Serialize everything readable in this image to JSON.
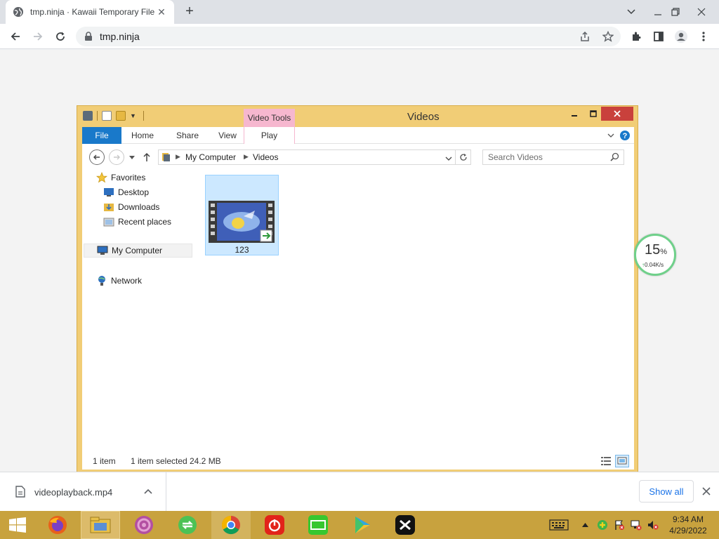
{
  "browser": {
    "tab_title": "tmp.ninja · Kawaii Temporary File",
    "url": "tmp.ninja",
    "new_tab_label": "+",
    "tab_close_label": "✕"
  },
  "explorer": {
    "window_title": "Videos",
    "contextual_tab": "Video Tools",
    "ribbon_tabs": [
      "File",
      "Home",
      "Share",
      "View",
      "Play"
    ],
    "breadcrumb": [
      "My Computer",
      "Videos"
    ],
    "search_placeholder": "Search Videos",
    "nav": {
      "favorites": "Favorites",
      "desktop": "Desktop",
      "downloads": "Downloads",
      "recent": "Recent places",
      "my_computer": "My Computer",
      "network": "Network"
    },
    "files": [
      {
        "name": "123"
      }
    ],
    "status": {
      "count": "1 item",
      "selected": "1 item selected",
      "size": "24.2 MB"
    }
  },
  "speed_widget": {
    "percent": "15",
    "percent_sign": "%",
    "rate": "0.04K/s"
  },
  "download_shelf": {
    "filename": "videoplayback.mp4",
    "show_all": "Show all"
  },
  "taskbar": {
    "time": "9:34 AM",
    "date": "4/29/2022",
    "apps": [
      "firefox",
      "file-explorer",
      "music-app",
      "sync-app",
      "chrome",
      "netease-music",
      "iqiyi",
      "video-player",
      "capcut"
    ]
  },
  "colors": {
    "window_frame": "#f1cd76",
    "file_tab": "#1979ca",
    "video_tools": "#f6b7cf",
    "close_button": "#c9413c",
    "taskbar": "#c8a23e",
    "selection": "#cce8ff"
  }
}
